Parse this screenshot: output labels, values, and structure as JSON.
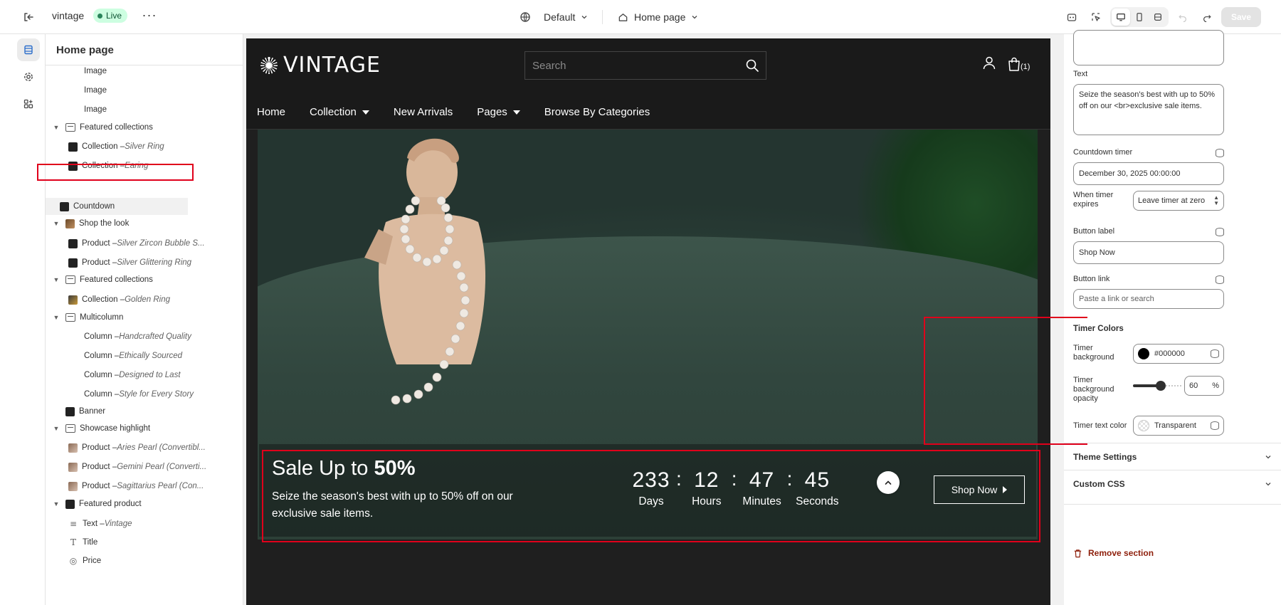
{
  "topbar": {
    "store_name": "vintage",
    "live_badge": "Live",
    "theme_selector": "Default",
    "page_selector": "Home page",
    "save_label": "Save"
  },
  "sidebar": {
    "title": "Home page",
    "items": [
      {
        "label": "Image",
        "sub": "",
        "kind": "none"
      },
      {
        "label": "Image",
        "sub": "",
        "kind": "none"
      },
      {
        "label": "Image",
        "sub": "",
        "kind": "none"
      },
      {
        "label": "Featured collections",
        "sub": "",
        "kind": "section"
      },
      {
        "label": "Collection – ",
        "sub": "Silver Ring",
        "kind": "thumb"
      },
      {
        "label": "Collection – ",
        "sub": "Earing",
        "kind": "thumb"
      },
      {
        "label": "Countdown",
        "sub": "",
        "kind": "thumb"
      },
      {
        "label": "Shop the look",
        "sub": "",
        "kind": "section"
      },
      {
        "label": "Product – ",
        "sub": "Silver Zircon Bubble S...",
        "kind": "thumb"
      },
      {
        "label": "Product – ",
        "sub": "Silver Glittering Ring",
        "kind": "thumb"
      },
      {
        "label": "Featured collections",
        "sub": "",
        "kind": "section"
      },
      {
        "label": "Collection – ",
        "sub": "Golden Ring",
        "kind": "thumb"
      },
      {
        "label": "Multicolumn",
        "sub": "",
        "kind": "section"
      },
      {
        "label": "Column – ",
        "sub": "Handcrafted Quality",
        "kind": "none"
      },
      {
        "label": "Column – ",
        "sub": "Ethically Sourced",
        "kind": "none"
      },
      {
        "label": "Column – ",
        "sub": "Designed to Last",
        "kind": "none"
      },
      {
        "label": "Column – ",
        "sub": "Style for Every Story",
        "kind": "none"
      },
      {
        "label": "Banner",
        "sub": "",
        "kind": "thumb"
      },
      {
        "label": "Showcase highlight",
        "sub": "",
        "kind": "section"
      },
      {
        "label": "Product – ",
        "sub": "Aries Pearl (Convertibl...",
        "kind": "thumb"
      },
      {
        "label": "Product – ",
        "sub": "Gemini Pearl (Converti...",
        "kind": "thumb"
      },
      {
        "label": "Product – ",
        "sub": "Sagittarius Pearl (Con...",
        "kind": "thumb"
      },
      {
        "label": "Featured product",
        "sub": "",
        "kind": "section"
      },
      {
        "label": "Text – ",
        "sub": "Vintage",
        "kind": "text"
      },
      {
        "label": "Title",
        "sub": "",
        "kind": "title"
      },
      {
        "label": "Price",
        "sub": "",
        "kind": "price"
      }
    ]
  },
  "store": {
    "logo_text": "VINTAGE",
    "search_placeholder": "Search",
    "cart_count": "(1)",
    "nav": [
      "Home",
      "Collection",
      "New Arrivals",
      "Pages",
      "Browse By Categories"
    ],
    "countdown": {
      "title_prefix": "Sale Up to ",
      "title_bold": "50%",
      "text": "Seize the season's best with up to 50% off on our exclusive sale items.",
      "days": "233",
      "hours": "12",
      "minutes": "47",
      "seconds": "45",
      "days_label": "Days",
      "hours_label": "Hours",
      "minutes_label": "Minutes",
      "seconds_label": "Seconds",
      "button": "Shop Now"
    }
  },
  "settings": {
    "text_label": "Text",
    "text_value": "Seize the season's best with up to 50% off on our <br>exclusive sale items.",
    "countdown_label": "Countdown timer",
    "countdown_value": "December  30, 2025 00:00:00",
    "expires_label": "When timer expires",
    "expires_value": "Leave timer at zero",
    "button_label_label": "Button label",
    "button_label_value": "Shop Now",
    "button_link_label": "Button link",
    "button_link_placeholder": "Paste a link or search",
    "timer_colors_title": "Timer Colors",
    "timer_bg_label": "Timer background",
    "timer_bg_value": "#000000",
    "timer_opacity_label": "Timer background opacity",
    "timer_opacity_value": "60",
    "timer_opacity_unit": "%",
    "timer_opacity_fraction": 0.6,
    "timer_text_label": "Timer text color",
    "timer_text_value": "Transparent",
    "theme_settings": "Theme Settings",
    "custom_css": "Custom CSS",
    "remove_section": "Remove section"
  },
  "colors": {
    "accent_red": "#e0001b",
    "live_green": "#29845a",
    "timer_bg": "#000000"
  }
}
